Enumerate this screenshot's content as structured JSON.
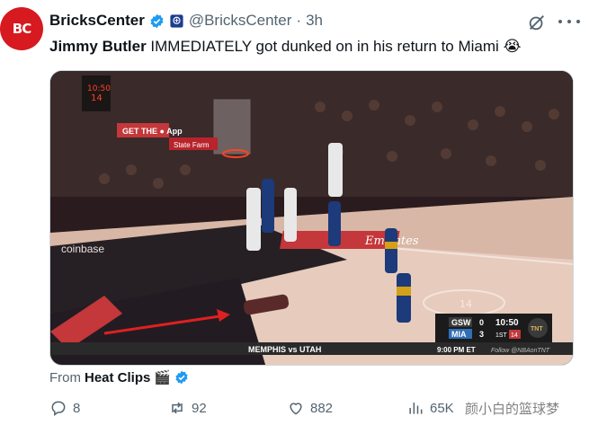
{
  "avatar": {
    "text": "BC"
  },
  "header": {
    "name": "BricksCenter",
    "handle": "@BricksCenter",
    "separator": "·",
    "time": "3h"
  },
  "tweet": {
    "text_bold": "Jimmy Butler",
    "text_rest": " IMMEDIATELY got dunked on in his return to Miami",
    "emoji": "😭"
  },
  "media": {
    "sponsor_sign": "GET THE ● App",
    "statefarm": "State Farm",
    "coinbase": "coinbase",
    "court_logo": "Emirates",
    "court_number": "14",
    "shot_clock": "14",
    "scoreboard": {
      "team1": "GSW",
      "score1": "0",
      "team2": "MIA",
      "score2": "3",
      "clock": "10:50",
      "period": "1ST",
      "shot": "14",
      "network": "TNT"
    },
    "ticker": {
      "game": "MEMPHIS vs UTAH",
      "time": "9:00 PM ET",
      "handle": "Follow @NBAonTNT"
    }
  },
  "source": {
    "prefix": "From",
    "name": "Heat Clips",
    "emoji": "🎬"
  },
  "actions": {
    "replies": "8",
    "retweets": "92",
    "likes": "882",
    "views": "65K"
  },
  "watermark": "颜小白的篮球梦",
  "colors": {
    "accent": "#1d9bf0",
    "muted": "#536471",
    "brand": "#d71920"
  }
}
